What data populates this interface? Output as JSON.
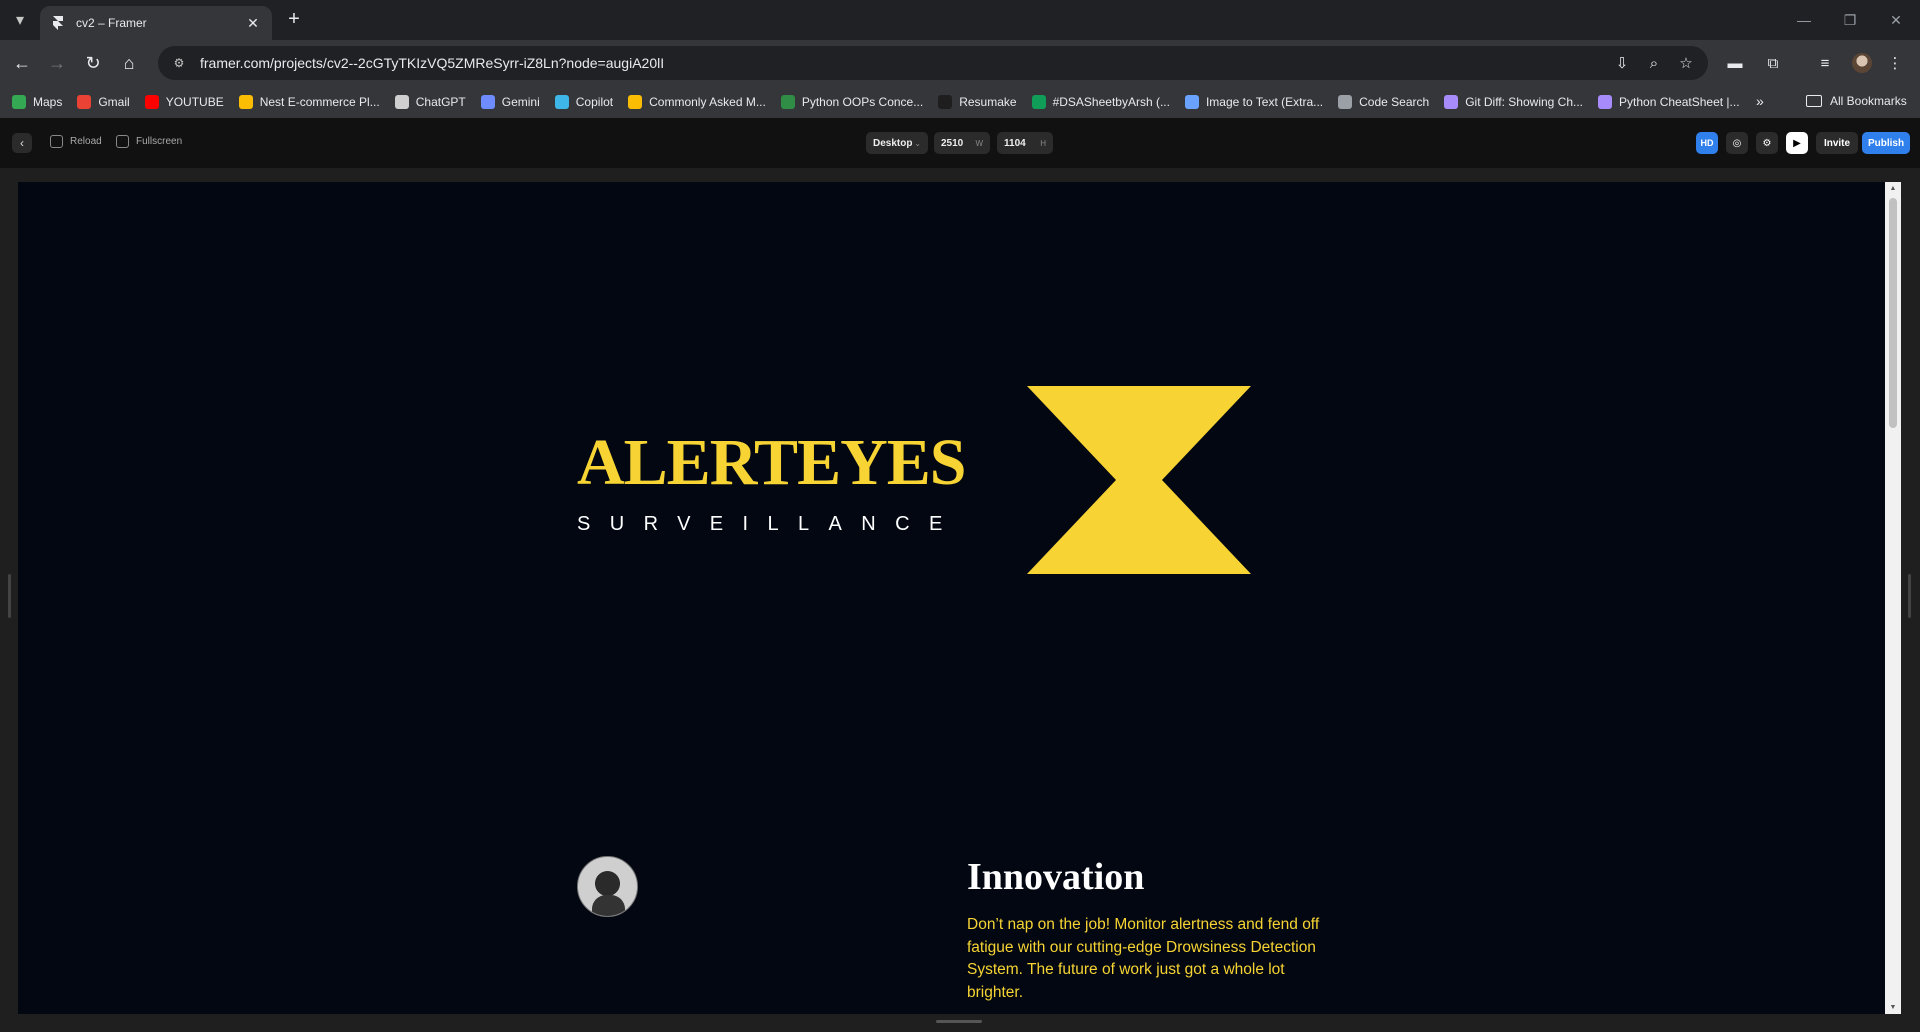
{
  "browser": {
    "tab_title": "cv2 – Framer",
    "url": "framer.com/projects/cv2--2cGTyTKIzVQ5ZMReSyrr-iZ8Ln?node=augiA20lI",
    "bookmarks": [
      {
        "label": "Maps",
        "color": "#34a853"
      },
      {
        "label": "Gmail",
        "color": "#ea4335"
      },
      {
        "label": "YOUTUBE",
        "color": "#ff0000"
      },
      {
        "label": "Nest E-commerce Pl...",
        "color": "#fbbc04"
      },
      {
        "label": "ChatGPT",
        "color": "#cfcfcf"
      },
      {
        "label": "Gemini",
        "color": "#6f8cff"
      },
      {
        "label": "Copilot",
        "color": "#3fb6e8"
      },
      {
        "label": "Commonly Asked M...",
        "color": "#fbbc04"
      },
      {
        "label": "Python OOPs Conce...",
        "color": "#2f8d46"
      },
      {
        "label": "Resumake",
        "color": "#1e1e1e"
      },
      {
        "label": "#DSASheetbyArsh (...",
        "color": "#0f9d58"
      },
      {
        "label": "Image to Text (Extra...",
        "color": "#6aa3ff"
      },
      {
        "label": "Code Search",
        "color": "#9aa0a6"
      },
      {
        "label": "Git Diff: Showing Ch...",
        "color": "#a78bfa"
      },
      {
        "label": "Python CheatSheet |...",
        "color": "#a78bfa"
      }
    ],
    "all_bookmarks": "All Bookmarks"
  },
  "framer": {
    "reload": "Reload",
    "fullscreen": "Fullscreen",
    "device": "Desktop",
    "width": "2510",
    "width_unit": "W",
    "height": "1104",
    "height_unit": "H",
    "hd": "HD",
    "invite": "Invite",
    "publish": "Publish"
  },
  "site": {
    "brand": "ALERTEYES",
    "brand_sub": "SURVEILLANCE",
    "innovation_title": "Innovation",
    "innovation_text": "Don’t nap on the job! Monitor alertness and fend off fatigue with our cutting-edge Drowsiness Detection System. The future of work just got a whole lot brighter."
  },
  "colors": {
    "accent_yellow": "#f7d433",
    "canvas_bg": "#020712",
    "publish_blue": "#2f80ed"
  }
}
